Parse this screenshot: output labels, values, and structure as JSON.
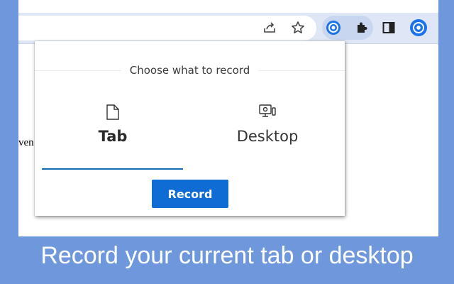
{
  "toolbar": {
    "icons": [
      "share-icon",
      "bookmark-star-icon",
      "recorder-extension-icon",
      "extensions-puzzle-icon",
      "side-panel-icon",
      "profile-icon"
    ]
  },
  "page": {
    "fragment_text": "ven"
  },
  "popup": {
    "heading": "Choose what to record",
    "options": [
      {
        "label": "Tab",
        "icon": "tab-page-icon",
        "selected": true
      },
      {
        "label": "Desktop",
        "icon": "desktop-monitor-icon",
        "selected": false
      }
    ],
    "record_label": "Record"
  },
  "caption": "Record your current tab or desktop",
  "colors": {
    "background": "#6f98dc",
    "accent": "#0f6cd4",
    "toolbar": "#dfe7f7"
  }
}
